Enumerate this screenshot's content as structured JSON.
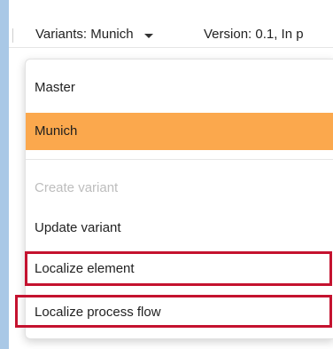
{
  "toolbar": {
    "variants_label": "Variants: Munich",
    "version_label": "Version: 0.1, In p"
  },
  "menu": {
    "items": [
      {
        "label": "Master",
        "selected": false,
        "disabled": false
      },
      {
        "label": "Munich",
        "selected": true,
        "disabled": false
      },
      {
        "label": "Create variant",
        "selected": false,
        "disabled": true
      },
      {
        "label": "Update variant",
        "selected": false,
        "disabled": false
      },
      {
        "label": "Localize element",
        "selected": false,
        "disabled": false,
        "highlighted": true
      },
      {
        "label": "Localize process flow",
        "selected": false,
        "disabled": false,
        "highlighted": true
      }
    ]
  },
  "colors": {
    "selected_background": "#fba84d",
    "highlight_border": "#c4122f",
    "disabled_text": "#bdbdbd",
    "side_strip": "#a9c8e6"
  }
}
